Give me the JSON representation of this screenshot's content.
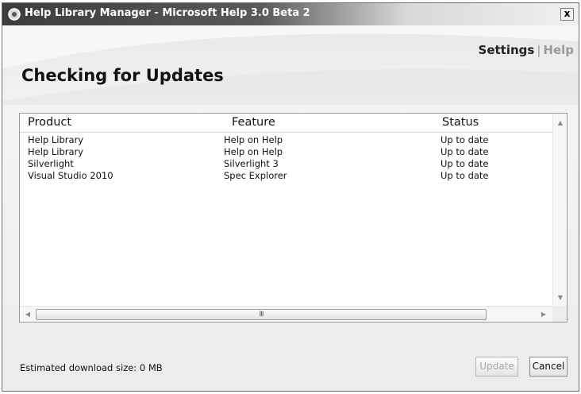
{
  "window": {
    "title": "Help Library Manager - Microsoft Help 3.0 Beta 2",
    "close_label": "x"
  },
  "header": {
    "settings_link": "Settings",
    "separator": "|",
    "help_link": "Help",
    "page_title": "Checking for Updates"
  },
  "table": {
    "columns": [
      "Product",
      "Feature",
      "Status"
    ],
    "rows": [
      {
        "product": "Help Library",
        "feature": "Help on Help",
        "status": "Up to date"
      },
      {
        "product": "Help Library",
        "feature": "Help on Help",
        "status": "Up to date"
      },
      {
        "product": "Silverlight",
        "feature": "Silverlight 3",
        "status": "Up to date"
      },
      {
        "product": "Visual Studio 2010",
        "feature": "Spec Explorer",
        "status": "Up to date"
      }
    ]
  },
  "footer": {
    "download_size": "Estimated download size: 0 MB",
    "update_label": "Update",
    "cancel_label": "Cancel"
  },
  "scrollbar": {
    "grip": "III"
  },
  "icons": {
    "app": "help-library-gear-icon",
    "close": "close-icon",
    "scroll_up": "scroll-up-arrow-icon",
    "scroll_down": "scroll-down-arrow-icon",
    "scroll_left": "scroll-left-arrow-icon",
    "scroll_right": "scroll-right-arrow-icon"
  },
  "colors": {
    "titlebar_dark": "#3c3c3c",
    "disabled_text": "#a8a8a8",
    "help_link": "#9a9a9a"
  }
}
